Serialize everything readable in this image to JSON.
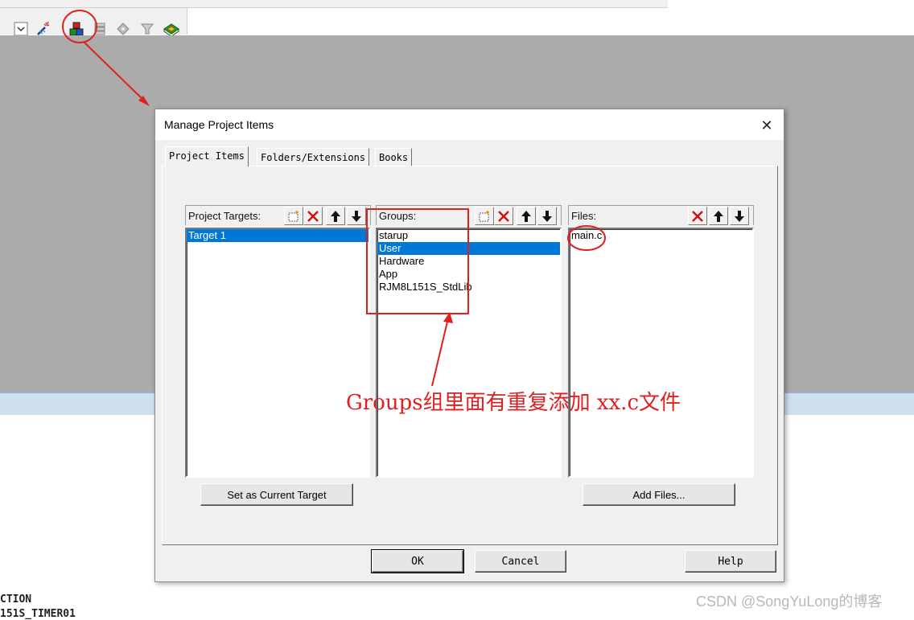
{
  "dialog": {
    "title": "Manage Project Items",
    "close_glyph": "✕",
    "tabs": [
      {
        "label": "Project Items",
        "active": true
      },
      {
        "label": "Folders/Extensions",
        "active": false
      },
      {
        "label": "Books",
        "active": false
      }
    ],
    "targets": {
      "header": "Project Targets:",
      "items": [
        {
          "label": "Target 1",
          "selected": true
        }
      ]
    },
    "groups": {
      "header": "Groups:",
      "items": [
        {
          "label": "starup",
          "selected": false
        },
        {
          "label": "User",
          "selected": true
        },
        {
          "label": "Hardware",
          "selected": false
        },
        {
          "label": "App",
          "selected": false
        },
        {
          "label": "RJM8L151S_StdLib",
          "selected": false
        }
      ]
    },
    "files": {
      "header": "Files:",
      "items": [
        {
          "label": "main.c",
          "selected": false
        }
      ]
    },
    "buttons": {
      "set_current_target": "Set as Current Target",
      "add_files": "Add Files...",
      "ok": "OK",
      "cancel": "Cancel",
      "help": "Help"
    }
  },
  "toolbar": {
    "icons": [
      "dropdown-arrow-icon",
      "magic-wand-icon",
      "manage-project-items-icon",
      "layers-icon",
      "diamond-icon",
      "funnel-icon",
      "pack-installer-icon"
    ]
  },
  "annotation": {
    "text": "Groups组里面有重复添加 xx.c文件",
    "color": "#e02020"
  },
  "background_code": {
    "line1": "CTION",
    "line2": "151S_TIMER01"
  },
  "watermark": "CSDN @SongYuLong的博客",
  "colors": {
    "selection": "#0078d7",
    "annotation": "#e02020",
    "ide_background": "#ababab"
  }
}
